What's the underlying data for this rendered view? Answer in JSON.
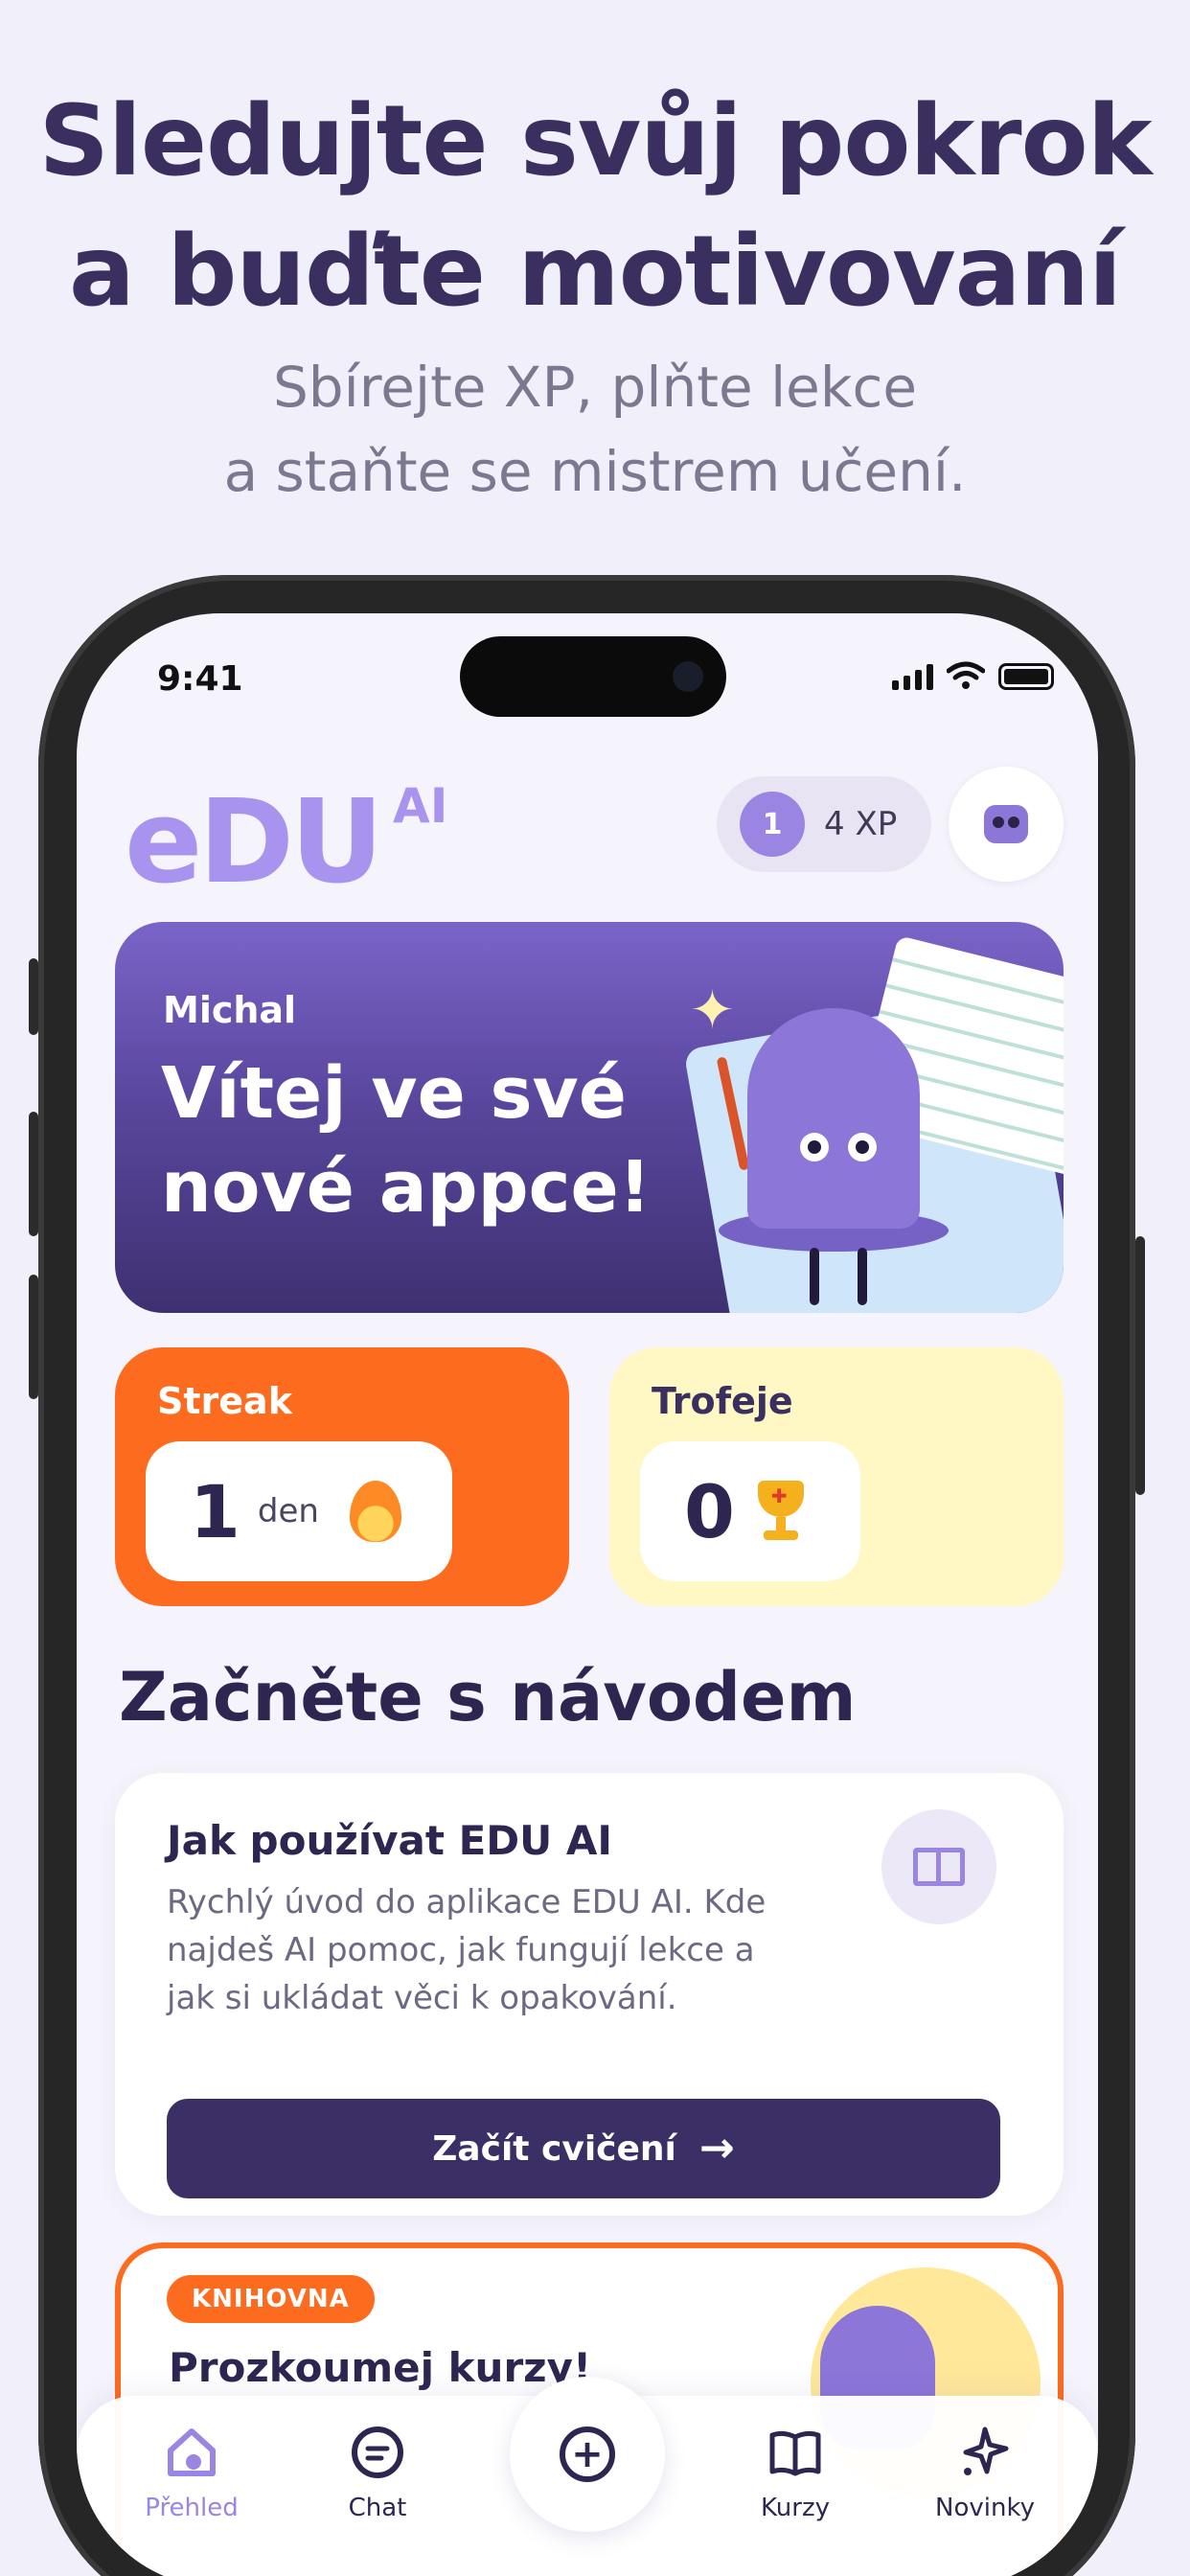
{
  "marketing": {
    "headline_line1": "Sledujte svůj pokrok",
    "headline_line2": "a buďte motivovaní",
    "subline_line1": "Sbírejte XP, plňte lekce",
    "subline_line2": "a staňte se mistrem učení."
  },
  "status_bar": {
    "time": "9:41"
  },
  "header": {
    "logo": "eDU",
    "logo_suffix": "AI",
    "xp_level": "1",
    "xp_label": "4 XP"
  },
  "welcome": {
    "name": "Michal",
    "title": "Vítej ve své nové appce!"
  },
  "stats": {
    "streak_label": "Streak",
    "streak_value": "1",
    "streak_unit": "den",
    "trophies_label": "Trofeje",
    "trophies_value": "0"
  },
  "section": {
    "title": "Začněte s návodem"
  },
  "guide": {
    "title": "Jak používat EDU AI",
    "description": "Rychlý úvod do aplikace EDU AI. Kde najdeš AI pomoc, jak fungují lekce a jak si ukládat věci k opakování.",
    "button_label": "Začít cvičení",
    "button_icon": "arrow-right-icon"
  },
  "library": {
    "badge": "KNIHOVNA",
    "title": "Prozkoumej kurzy!"
  },
  "nav": {
    "items": [
      {
        "label": "Přehled",
        "icon": "home-icon",
        "active": true
      },
      {
        "label": "Chat",
        "icon": "chat-icon",
        "active": false
      },
      {
        "label": "",
        "icon": "plus-icon",
        "active": false
      },
      {
        "label": "Kurzy",
        "icon": "book-icon",
        "active": false
      },
      {
        "label": "Novinky",
        "icon": "sparkles-icon",
        "active": false
      }
    ]
  },
  "colors": {
    "brand_purple": "#9a86e2",
    "dark_purple": "#3b2f66",
    "streak_orange": "#fd6b1e",
    "trophy_yellow": "#fff8c4",
    "background": "#f1eff9"
  }
}
